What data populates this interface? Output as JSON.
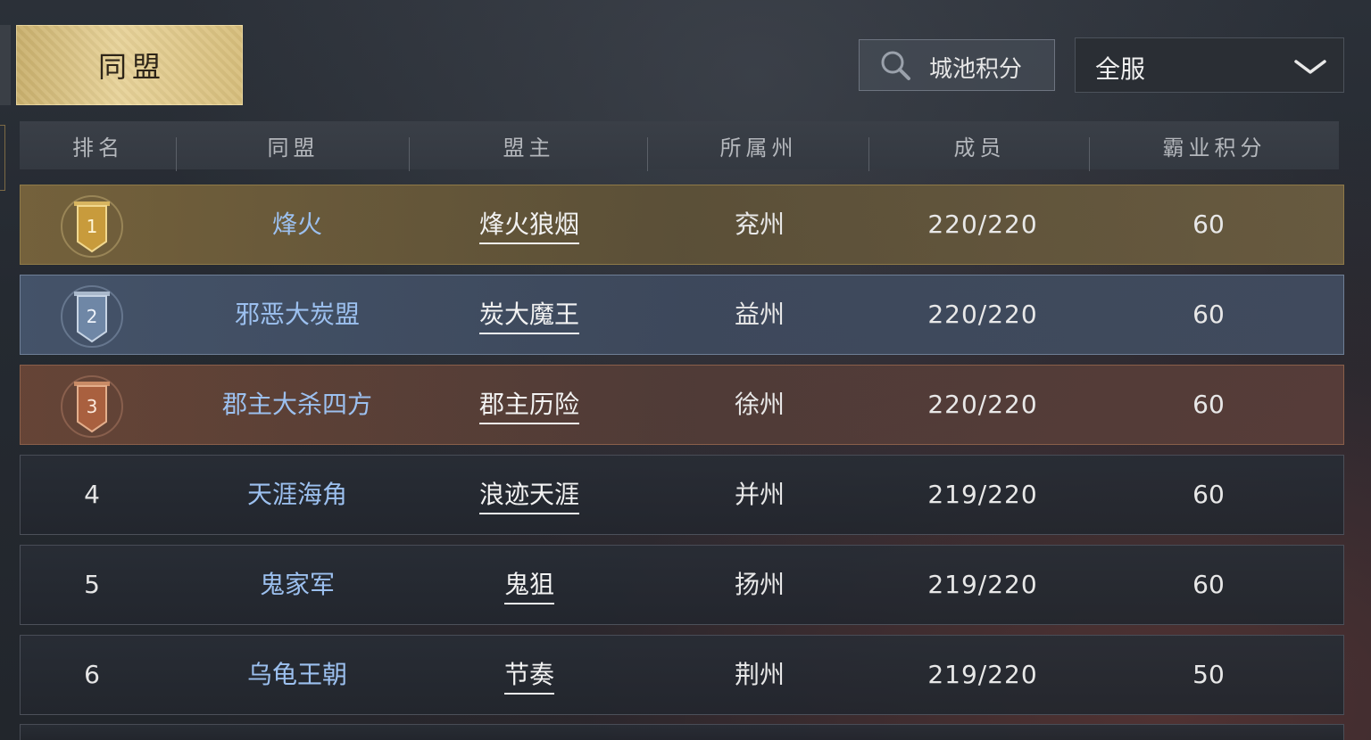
{
  "tab": {
    "label": "同盟"
  },
  "search": {
    "label": "城池积分"
  },
  "server_filter": {
    "value": "全服"
  },
  "columns": [
    "排名",
    "同盟",
    "盟主",
    "所属州",
    "成员",
    "霸业积分"
  ],
  "rows": [
    {
      "rank": "1",
      "alliance": "烽火",
      "leader": "烽火狼烟",
      "state": "兖州",
      "members": "220/220",
      "score": "60"
    },
    {
      "rank": "2",
      "alliance": "邪恶大炭盟",
      "leader": "炭大魔王",
      "state": "益州",
      "members": "220/220",
      "score": "60"
    },
    {
      "rank": "3",
      "alliance": "郡主大杀四方",
      "leader": "郡主历险",
      "state": "徐州",
      "members": "220/220",
      "score": "60"
    },
    {
      "rank": "4",
      "alliance": "天涯海角",
      "leader": "浪迹天涯",
      "state": "并州",
      "members": "219/220",
      "score": "60"
    },
    {
      "rank": "5",
      "alliance": "鬼家军",
      "leader": "鬼狙",
      "state": "扬州",
      "members": "219/220",
      "score": "60"
    },
    {
      "rank": "6",
      "alliance": "乌龟王朝",
      "leader": "节奏",
      "state": "荆州",
      "members": "219/220",
      "score": "50"
    }
  ],
  "colors": {
    "gold": "#c9b06d",
    "silver": "#8ea3bf",
    "bronze": "#b67454",
    "alliance_text": "#9cc0ef"
  },
  "icons": {
    "search": "search-icon",
    "dropdown": "chevron-down-icon",
    "rank_badges": [
      "gold-banner-icon",
      "silver-banner-icon",
      "bronze-banner-icon"
    ]
  }
}
